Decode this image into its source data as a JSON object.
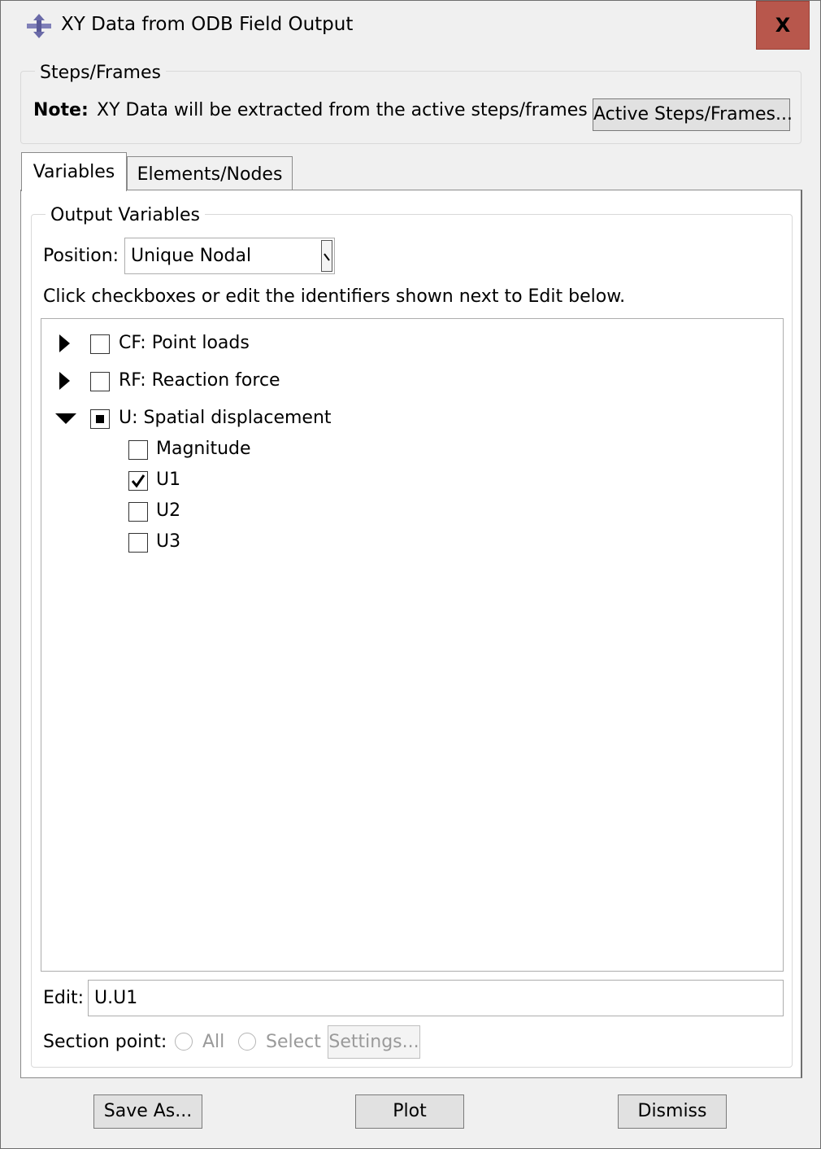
{
  "window": {
    "title": "XY Data from ODB Field Output",
    "close_label": "X"
  },
  "steps": {
    "group_label": "Steps/Frames",
    "note_label": "Note:",
    "note_text": "XY Data will be extracted from the active steps/frames",
    "active_button": "Active Steps/Frames..."
  },
  "tabs": [
    {
      "label": "Variables",
      "active": true
    },
    {
      "label": "Elements/Nodes",
      "active": false
    }
  ],
  "output": {
    "group_label": "Output Variables",
    "position_label": "Position:",
    "position_value": "Unique Nodal",
    "instruction": "Click checkboxes or edit the identifiers shown next to Edit below.",
    "tree": [
      {
        "label": "CF: Point loads",
        "expanded": false,
        "state": "unchecked"
      },
      {
        "label": "RF: Reaction force",
        "expanded": false,
        "state": "unchecked"
      },
      {
        "label": "U: Spatial displacement",
        "expanded": true,
        "state": "partial",
        "children": [
          {
            "label": "Magnitude",
            "checked": false
          },
          {
            "label": "U1",
            "checked": true
          },
          {
            "label": "U2",
            "checked": false
          },
          {
            "label": "U3",
            "checked": false
          }
        ]
      }
    ],
    "edit_label": "Edit:",
    "edit_value": "U.U1",
    "section_point_label": "Section point:",
    "radio_all": "All",
    "radio_select": "Select",
    "settings_button": "Settings..."
  },
  "footer": {
    "save_as": "Save As...",
    "plot": "Plot",
    "dismiss": "Dismiss"
  }
}
